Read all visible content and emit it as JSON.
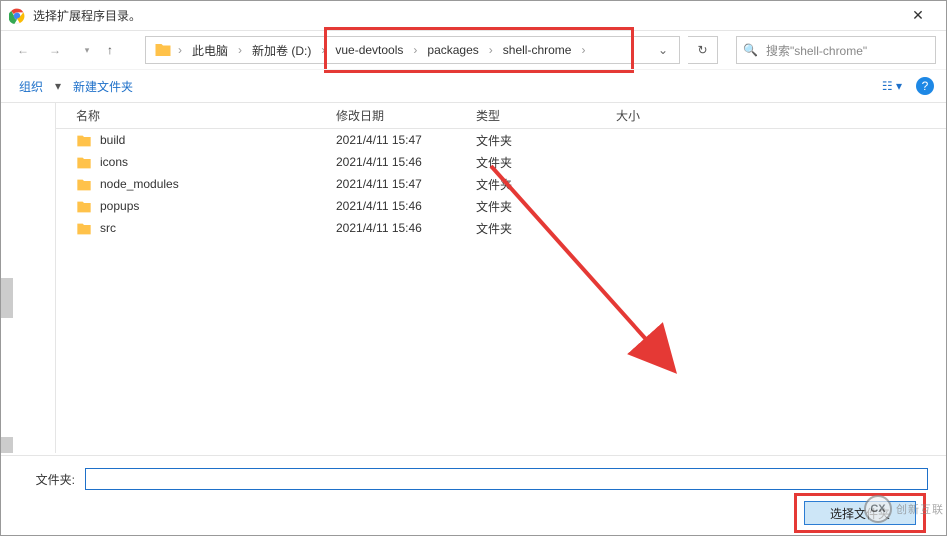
{
  "titlebar": {
    "title": "选择扩展程序目录。"
  },
  "breadcrumb": {
    "items": [
      "此电脑",
      "新加卷 (D:)",
      "vue-devtools",
      "packages",
      "shell-chrome"
    ]
  },
  "search": {
    "placeholder": "搜索\"shell-chrome\""
  },
  "toolbar": {
    "organize": "组织",
    "new_folder": "新建文件夹"
  },
  "columns": {
    "name": "名称",
    "date": "修改日期",
    "type": "类型",
    "size": "大小"
  },
  "rows": [
    {
      "name": "build",
      "date": "2021/4/11 15:47",
      "type": "文件夹"
    },
    {
      "name": "icons",
      "date": "2021/4/11 15:46",
      "type": "文件夹"
    },
    {
      "name": "node_modules",
      "date": "2021/4/11 15:47",
      "type": "文件夹"
    },
    {
      "name": "popups",
      "date": "2021/4/11 15:46",
      "type": "文件夹"
    },
    {
      "name": "src",
      "date": "2021/4/11 15:46",
      "type": "文件夹"
    }
  ],
  "footer": {
    "folder_label": "文件夹:",
    "folder_value": "",
    "action_label": "选择文件夹"
  },
  "watermark": {
    "text": "创新互联"
  }
}
